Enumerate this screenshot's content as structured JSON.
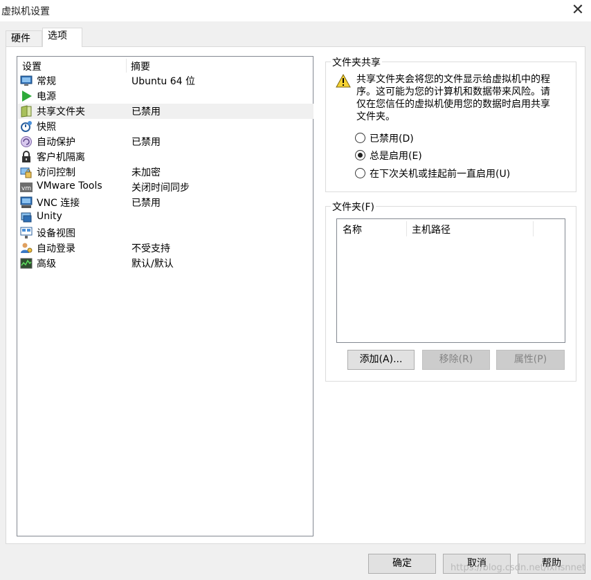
{
  "window": {
    "title": "虚拟机设置",
    "close_label": "✕"
  },
  "tabs": [
    {
      "label": "硬件"
    },
    {
      "label": "选项"
    }
  ],
  "settings_list": {
    "columns": {
      "setting": "设置",
      "summary": "摘要"
    },
    "rows": [
      {
        "name": "常规",
        "summary": "Ubuntu 64 位",
        "icon": "general-icon"
      },
      {
        "name": "电源",
        "summary": "",
        "icon": "power-icon"
      },
      {
        "name": "共享文件夹",
        "summary": "已禁用",
        "icon": "shared-folder-icon"
      },
      {
        "name": "快照",
        "summary": "",
        "icon": "snapshot-icon"
      },
      {
        "name": "自动保护",
        "summary": "已禁用",
        "icon": "autoprotect-icon"
      },
      {
        "name": "客户机隔离",
        "summary": "",
        "icon": "lock-icon"
      },
      {
        "name": "访问控制",
        "summary": "未加密",
        "icon": "access-control-icon"
      },
      {
        "name": "VMware Tools",
        "summary": "关闭时间同步",
        "icon": "vmware-tools-icon"
      },
      {
        "name": "VNC 连接",
        "summary": "已禁用",
        "icon": "vnc-icon"
      },
      {
        "name": "Unity",
        "summary": "",
        "icon": "unity-icon"
      },
      {
        "name": "设备视图",
        "summary": "",
        "icon": "device-view-icon"
      },
      {
        "name": "自动登录",
        "summary": "不受支持",
        "icon": "autologin-icon"
      },
      {
        "name": "高级",
        "summary": "默认/默认",
        "icon": "advanced-icon"
      }
    ]
  },
  "folder_sharing": {
    "title": "文件夹共享",
    "description": "共享文件夹会将您的文件显示给虚拟机中的程序。这可能为您的计算机和数据带来风险。请仅在您信任的虚拟机使用您的数据时启用共享文件夹。",
    "options": [
      {
        "label": "已禁用(D)",
        "checked": false
      },
      {
        "label": "总是启用(E)",
        "checked": true
      },
      {
        "label": "在下次关机或挂起前一直启用(U)",
        "checked": false
      }
    ]
  },
  "folders": {
    "title": "文件夹(F)",
    "columns": {
      "name": "名称",
      "host_path": "主机路径"
    },
    "add_label": "添加(A)...",
    "remove_label": "移除(R)",
    "properties_label": "属性(P)"
  },
  "footer": {
    "ok_label": "确定",
    "cancel_label": "取消",
    "help_label": "帮助"
  },
  "watermark": "https://blog.csdn.net/lxhsnnet"
}
